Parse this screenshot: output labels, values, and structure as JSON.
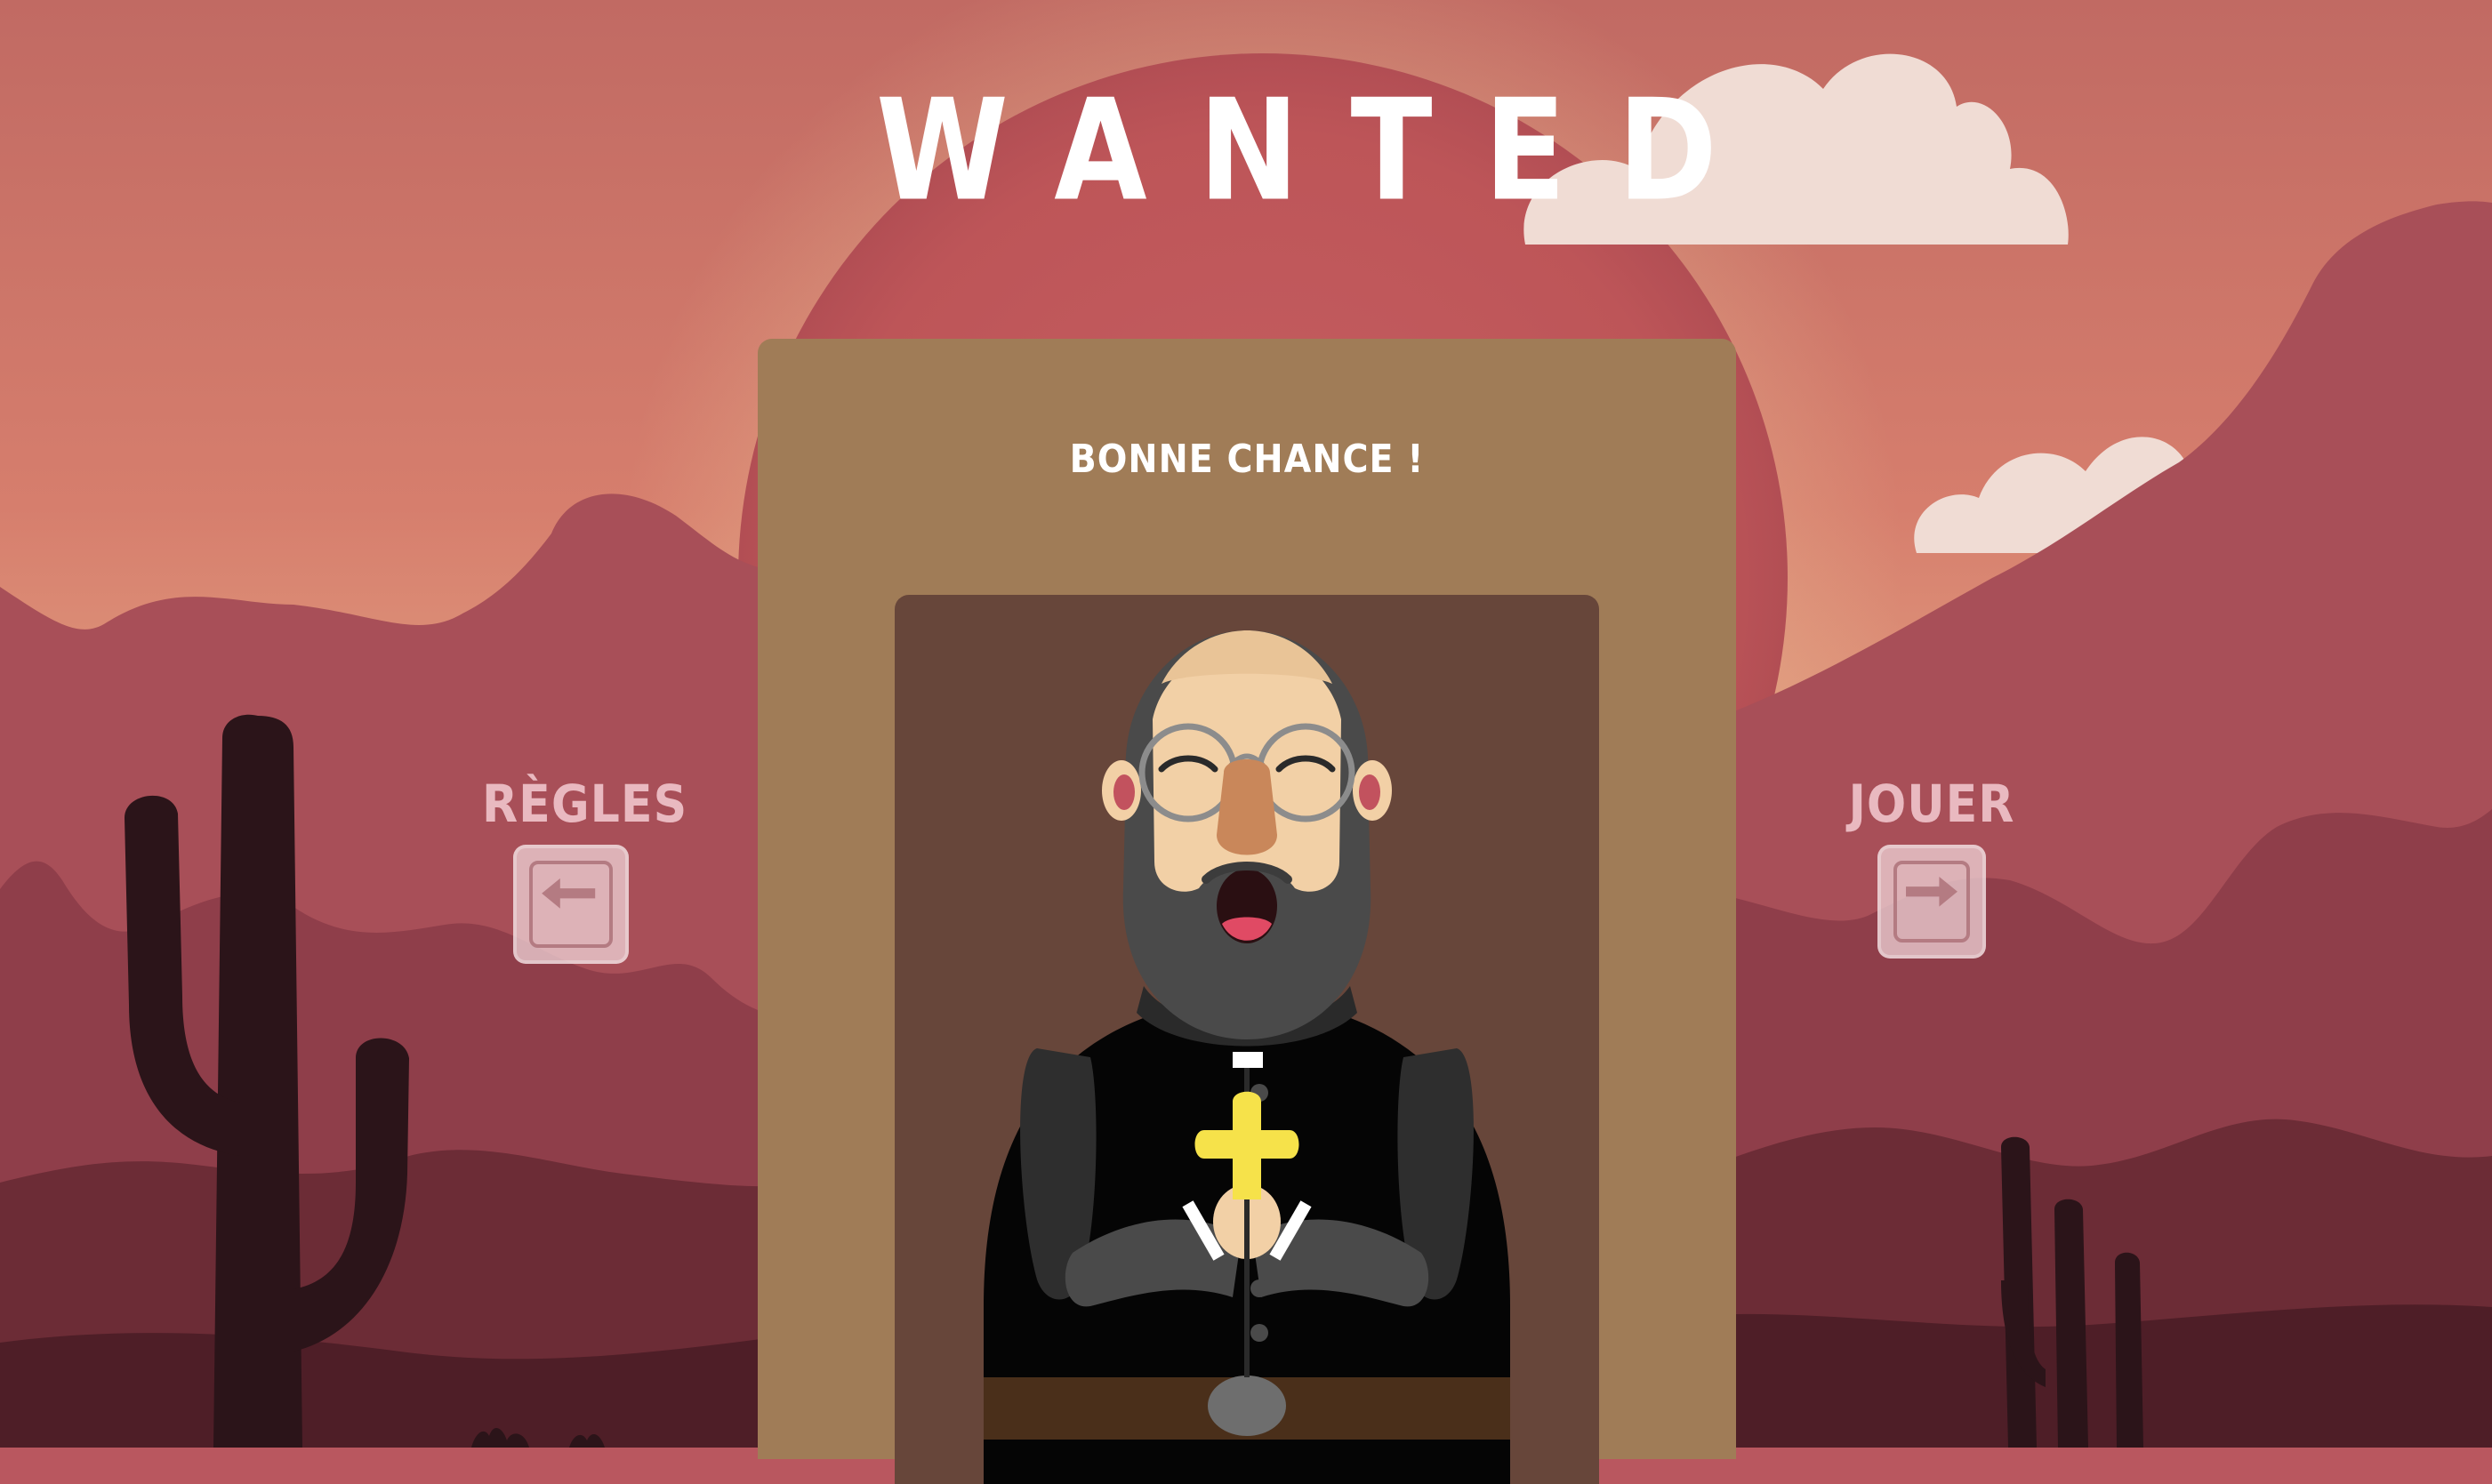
{
  "game": {
    "title": "WANTED",
    "message": "BONNE CHANCE !"
  },
  "nav": {
    "left": {
      "label": "RÈGLES",
      "icon": "arrow-left-key-icon"
    },
    "right": {
      "label": "JOUER",
      "icon": "arrow-right-key-icon"
    }
  },
  "character": {
    "icon": "priest-character-icon"
  },
  "colors": {
    "sky_top": "#c06a64",
    "sun": "#c45a5e",
    "mountain_far": "#a84f58",
    "mountain_mid": "#8f3e4a",
    "mountain_near": "#6c2c36",
    "ground": "#4e1e27",
    "cactus": "#2b1419",
    "poster": "#a07c57",
    "frame": "#67463a",
    "nav_label": "#e9b9c0"
  }
}
